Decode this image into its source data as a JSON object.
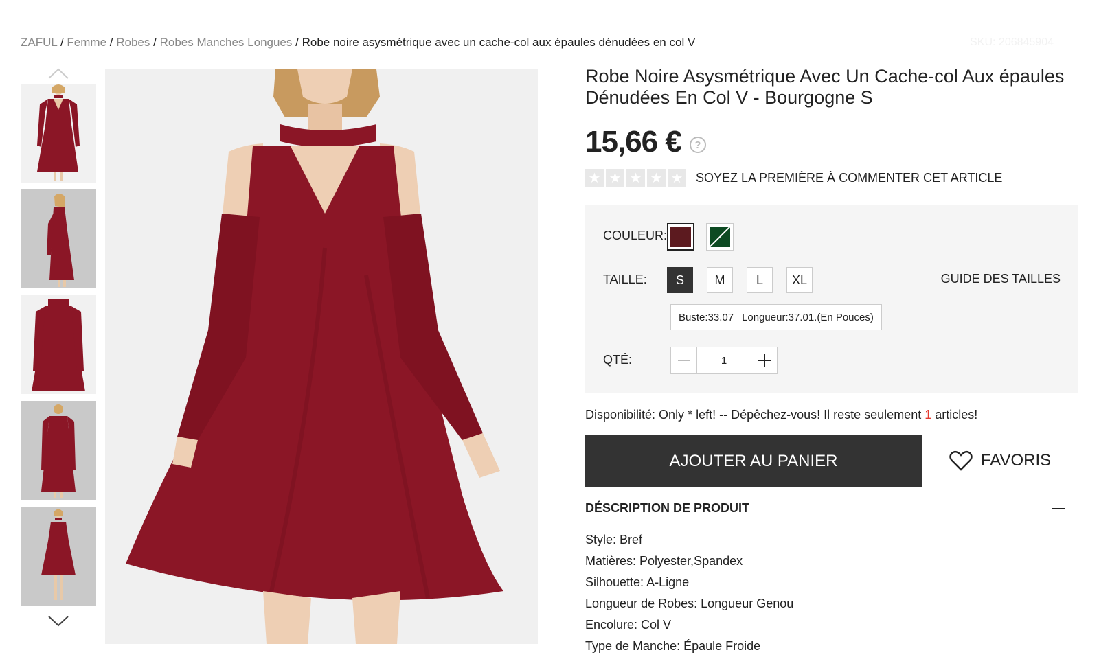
{
  "breadcrumb": {
    "items": [
      "ZAFUL",
      "Femme",
      "Robes",
      "Robes Manches Longues"
    ],
    "current": "Robe noire asysmétrique avec un cache-col aux épaules dénudées en col V",
    "separator": "/"
  },
  "sku": "SKU: 206845904",
  "product": {
    "title": "Robe Noire Asysmétrique Avec Un Cache-col Aux épaules Dénudées En Col V - Bourgogne S",
    "price": "15,66 €",
    "help_icon": "question-circle-icon",
    "review_link": "SOYEZ LA PREMIÈRE À COMMENTER CET ARTICLE",
    "rating": 0,
    "rating_max": 5
  },
  "options": {
    "color_label": "COULEUR:",
    "colors": [
      {
        "name": "Bourgogne",
        "hex": "#5c1a1f",
        "selected": true
      },
      {
        "name": "Vert",
        "hex": "#0d4a22",
        "selected": false,
        "unavailable": true
      }
    ],
    "size_label": "TAILLE:",
    "sizes": [
      "S",
      "M",
      "L",
      "XL"
    ],
    "selected_size": "S",
    "size_guide": "GUIDE DES TAILLES",
    "measure_bust": "Buste:33.07",
    "measure_length": "Longueur:37.01.(En Pouces)",
    "qty_label": "QTÉ:",
    "qty_value": "1"
  },
  "availability": {
    "prefix": "Disponibilité: Only * left! -- Dépêchez-vous! Il reste seulement",
    "count": "1",
    "suffix": "articles!"
  },
  "buttons": {
    "add_to_cart": "AJOUTER AU PANIER",
    "favorites": "FAVORIS"
  },
  "description": {
    "title": "DÉSCRIPTION DE PRODUIT",
    "lines": [
      "Style: Bref",
      "Matières: Polyester,Spandex",
      "Silhouette: A-Ligne",
      "Longueur de Robes: Longueur Genou",
      "Encolure: Col V",
      "Type de Manche: Épaule Froide"
    ]
  },
  "colors": {
    "dress": "#8b1626",
    "dark_button": "#333333",
    "accent_red": "#e53a2f"
  }
}
